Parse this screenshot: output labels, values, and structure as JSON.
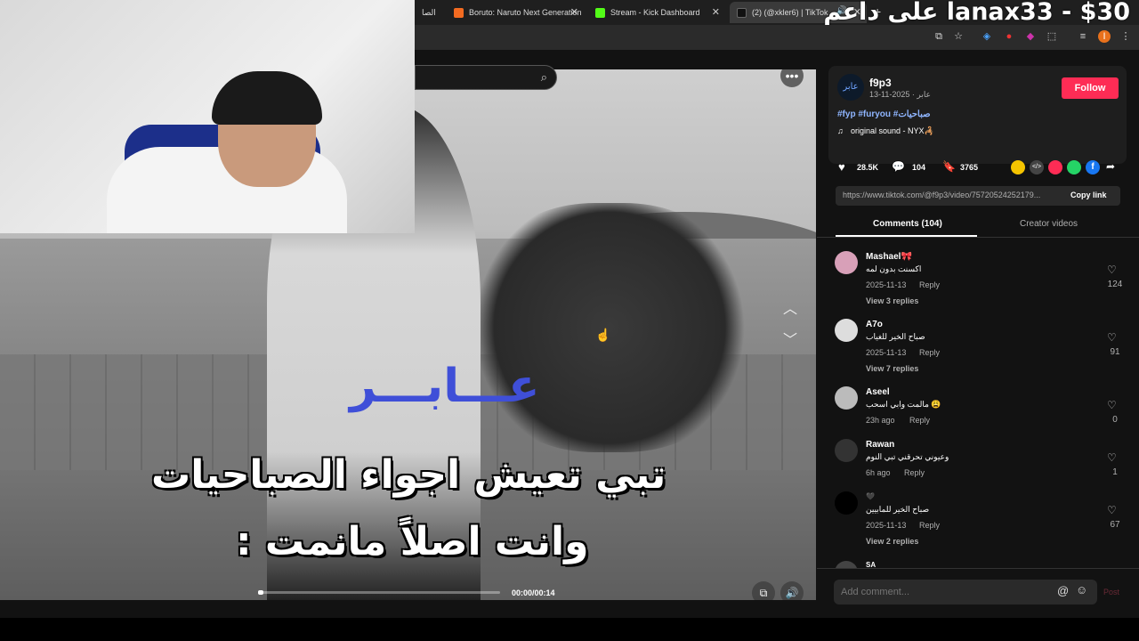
{
  "browser": {
    "tabs": [
      {
        "title": "الصا",
        "icon_color": "#888"
      },
      {
        "title": "Boruto: Naruto Next Generation",
        "icon_color": "#f36b21"
      },
      {
        "title": "Stream - Kick Dashboard",
        "icon_color": "#53fc18"
      },
      {
        "title": "(2) (@xkler6) | TikTok",
        "icon_color": "#111"
      }
    ],
    "new_tab": "+"
  },
  "stream_overlay": {
    "text": "على داعم lanax33 - $30"
  },
  "video": {
    "watermark": "عـــابـــر",
    "caption_line1": "تبي تعيش اجواء الصباحيات",
    "caption_line2": "وانت اصلاً مانمت :",
    "time": "00:00/00:14",
    "progress_fraction": 0.0
  },
  "post": {
    "author": "f9p3",
    "avatar_text": "عابر",
    "meta": "عابر · 2025-11-13",
    "follow_label": "Follow",
    "hashtags": "#fyp #furyou #صباحيات",
    "sound": "original sound - NYX🦂",
    "likes": "28.5K",
    "comments": "104",
    "saves": "3765",
    "link": "https://www.tiktok.com/@f9p3/video/75720524252179...",
    "copy_label": "Copy link",
    "share_colors": [
      "#f5c400",
      "#444",
      "#fe2c55",
      "#25d366",
      "#1877f2"
    ]
  },
  "tabs": {
    "comments": "Comments (104)",
    "creator": "Creator videos"
  },
  "comments": [
    {
      "user": "Mashael🎀",
      "text": "اكسنت بدون لمه",
      "date": "2025-11-13",
      "reply": "Reply",
      "likes": "124",
      "view_replies": "View 3 replies",
      "avatar_color": "#d8a0b8"
    },
    {
      "user": "A7o",
      "text": "صباح الخير للغياب",
      "date": "2025-11-13",
      "reply": "Reply",
      "likes": "91",
      "view_replies": "View 7 replies",
      "avatar_color": "#ddd"
    },
    {
      "user": "Aseel",
      "text": "مالمت وابي اسحب 😩",
      "date": "23h ago",
      "reply": "Reply",
      "likes": "0",
      "view_replies": "",
      "avatar_color": "#bbb"
    },
    {
      "user": "Rawan",
      "text": "وعيوني تحرقني تبي النوم",
      "date": "6h ago",
      "reply": "Reply",
      "likes": "1",
      "view_replies": "",
      "avatar_color": "#333"
    },
    {
      "user": "🖤",
      "text": "صباح الخير للمابيين",
      "date": "2025-11-13",
      "reply": "Reply",
      "likes": "67",
      "view_replies": "View 2 replies",
      "avatar_color": "#000"
    },
    {
      "user": "SA",
      "text": "",
      "date": "",
      "reply": "",
      "likes": "",
      "view_replies": "",
      "avatar_color": "#444"
    }
  ],
  "comment_box": {
    "placeholder": "Add comment...",
    "post_label": "Post"
  }
}
